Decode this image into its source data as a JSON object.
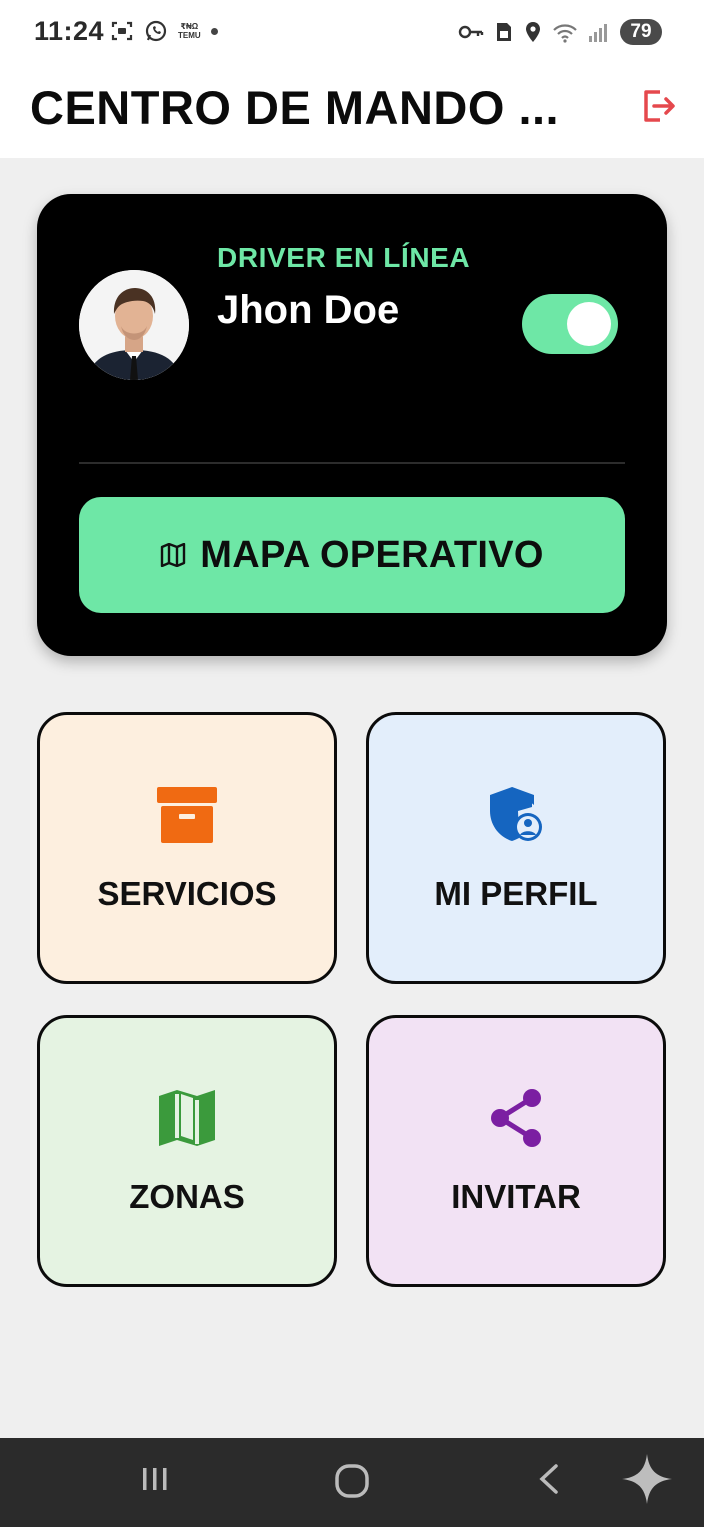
{
  "status_bar": {
    "time": "11:24",
    "temu_top": "₹₦Ω",
    "temu_bottom": "TEMU",
    "battery": "79"
  },
  "app_bar": {
    "title": "CENTRO DE MANDO ...",
    "logout_icon": "logout-icon",
    "logout_color": "#e5484d"
  },
  "driver_card": {
    "status_label": "DRIVER EN LÍNEA",
    "name": "Jhon Doe",
    "online": true,
    "accent_color": "#6ee7a6",
    "map_button_label": "MAPA OPERATIVO",
    "map_icon": "map-icon"
  },
  "tiles": [
    {
      "label": "SERVICIOS",
      "icon": "archive-box-icon",
      "bg": "#fdefdf",
      "icon_color": "#f06a12"
    },
    {
      "label": "MI PERFIL",
      "icon": "shield-user-icon",
      "bg": "#e3eefb",
      "icon_color": "#1565c0"
    },
    {
      "label": "ZONAS",
      "icon": "map-icon",
      "bg": "#e5f3e2",
      "icon_color": "#3b9a3c"
    },
    {
      "label": "INVITAR",
      "icon": "share-icon",
      "bg": "#f2e2f4",
      "icon_color": "#7b1fa2"
    }
  ],
  "nav_bar": {
    "items": [
      "recents-icon",
      "home-icon",
      "back-icon",
      "assistant-icon"
    ]
  }
}
